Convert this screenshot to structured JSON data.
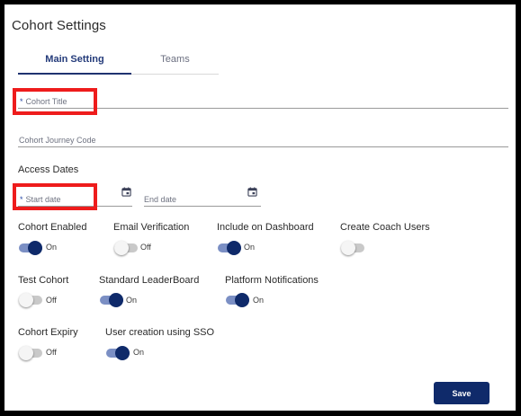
{
  "header": {
    "title": "Cohort Settings"
  },
  "tabs": [
    {
      "label": "Main Setting",
      "active": true
    },
    {
      "label": "Teams",
      "active": false
    }
  ],
  "form": {
    "required_mark": "*",
    "cohort_title": {
      "label": "Cohort Title",
      "value": "",
      "required": true
    },
    "journey_code": {
      "label": "Cohort Journey Code",
      "value": "",
      "required": false
    },
    "access_dates": {
      "title": "Access Dates",
      "start_label": "Start date",
      "start_required": true,
      "end_label": "End date",
      "calendar_icon": "calendar-icon"
    }
  },
  "toggles": {
    "cohort_enabled": {
      "label": "Cohort Enabled",
      "state": "On"
    },
    "email_verification": {
      "label": "Email Verification",
      "state": "Off"
    },
    "include_dashboard": {
      "label": "Include on Dashboard",
      "state": "On"
    },
    "create_coach": {
      "label": "Create Coach Users",
      "state": ""
    },
    "test_cohort": {
      "label": "Test Cohort",
      "state": "Off"
    },
    "standard_leaderboard": {
      "label": "Standard LeaderBoard",
      "state": "On"
    },
    "platform_notifications": {
      "label": "Platform Notifications",
      "state": "On"
    },
    "cohort_expiry": {
      "label": "Cohort Expiry",
      "state": "Off"
    },
    "sso_user_creation": {
      "label": "User creation using SSO",
      "state": "On"
    }
  },
  "actions": {
    "save_label": "Save"
  },
  "colors": {
    "accent": "#0f2a6a",
    "toggle_track_on": "#7b8fc4",
    "highlight_box": "#ee1c1c"
  }
}
